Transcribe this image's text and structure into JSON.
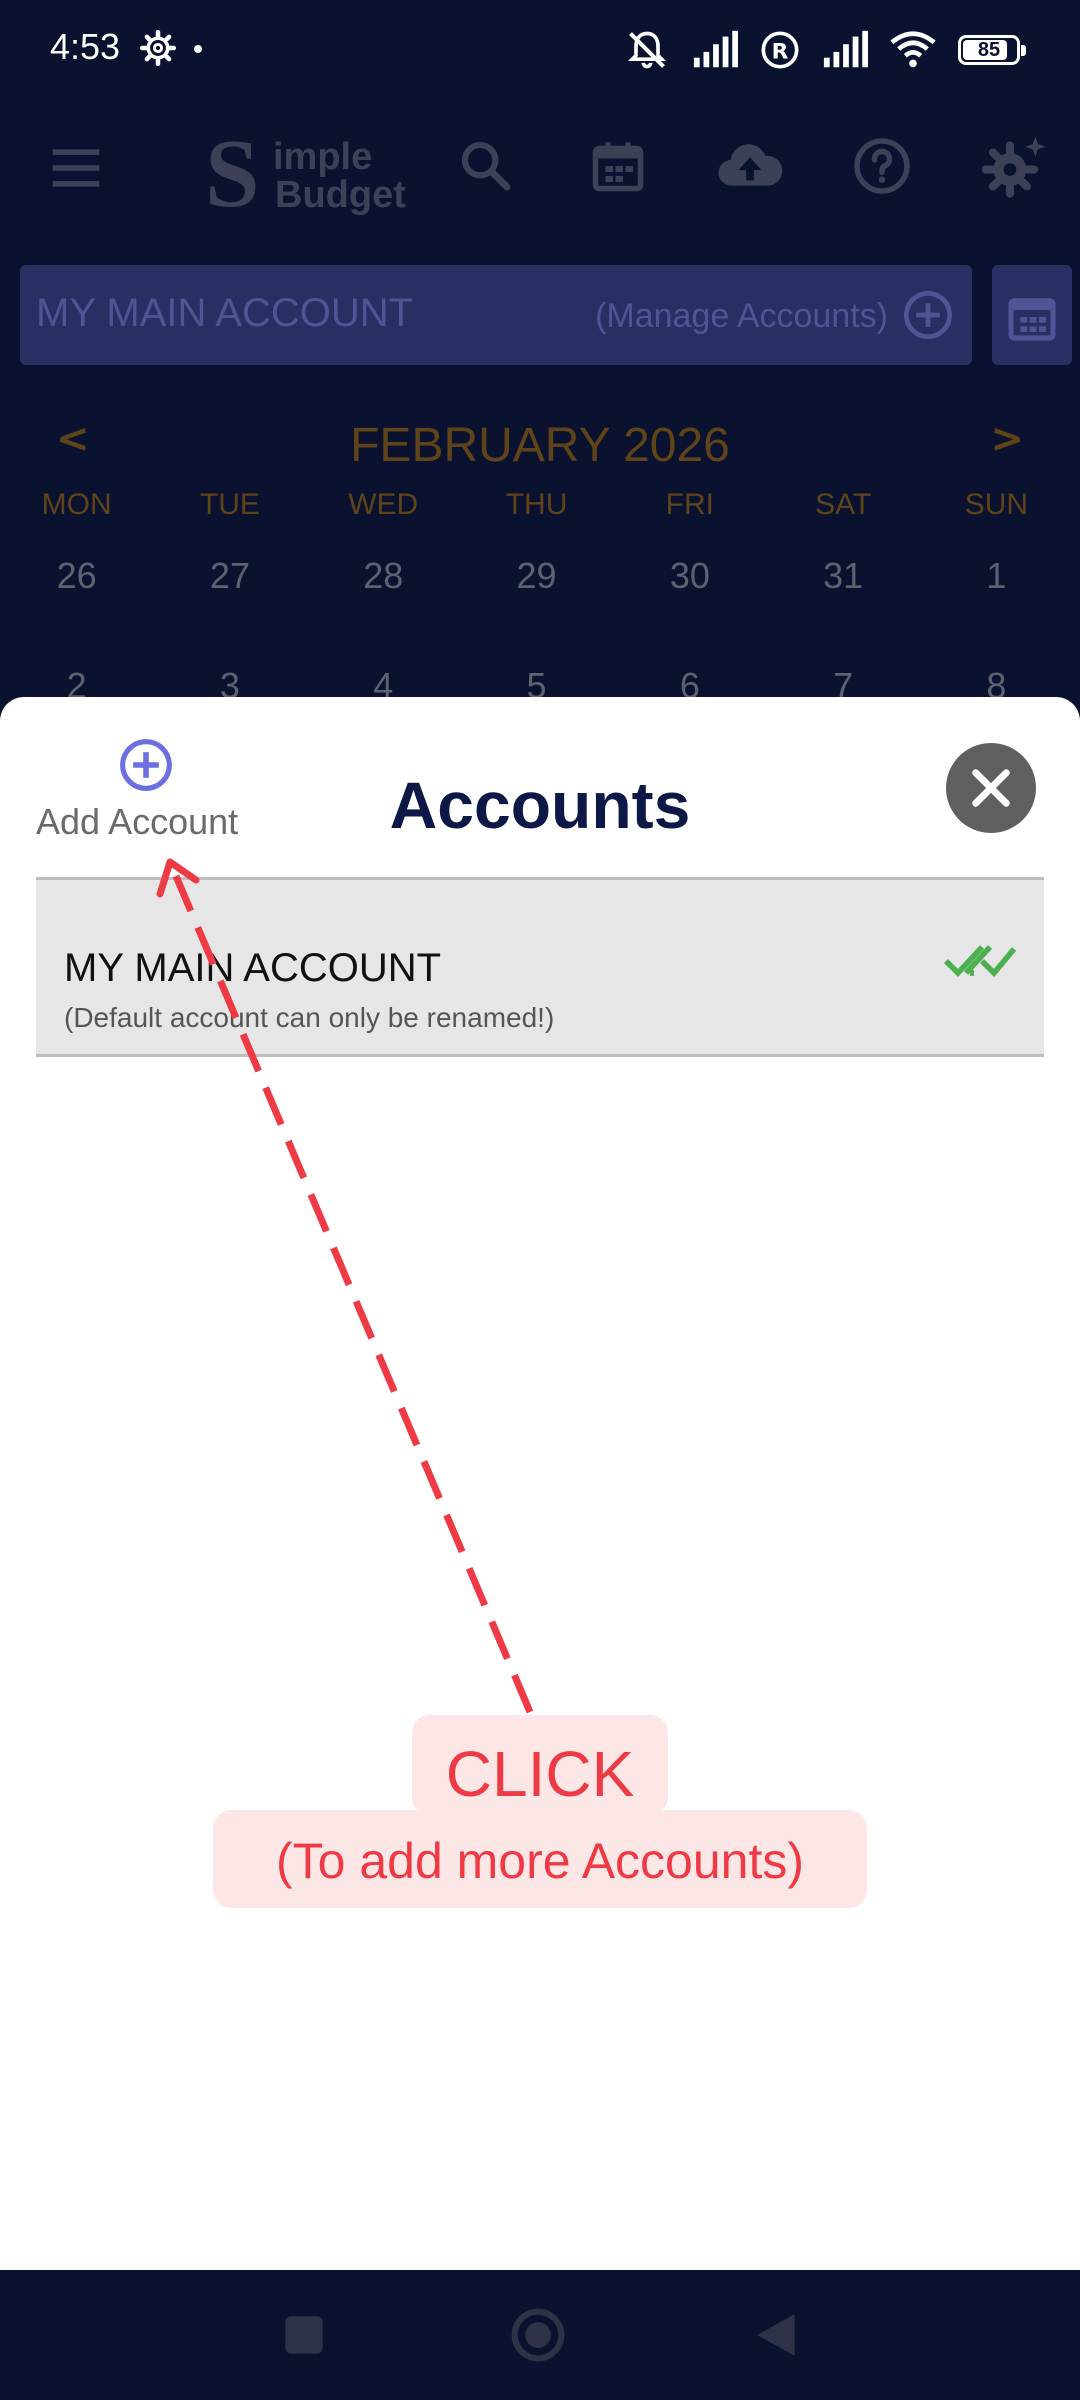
{
  "status_bar": {
    "time": "4:53",
    "battery": "85",
    "battery_level": 0.85
  },
  "app_bar": {
    "logo_letter": "S",
    "logo_line1": "imple",
    "logo_line2": "Budget"
  },
  "account_bar": {
    "account_name": "MY MAIN ACCOUNT",
    "manage_label": "(Manage Accounts)"
  },
  "calendar": {
    "prev": "<",
    "next": ">",
    "month_title": "FEBRUARY 2026",
    "weekdays": [
      "MON",
      "TUE",
      "WED",
      "THU",
      "FRI",
      "SAT",
      "SUN"
    ],
    "row1": [
      "26",
      "27",
      "28",
      "29",
      "30",
      "31",
      "1"
    ],
    "row2": [
      "2",
      "3",
      "4",
      "5",
      "6",
      "7",
      "8"
    ]
  },
  "dialog": {
    "add_account_label": "Add Account",
    "title": "Accounts",
    "accounts": [
      {
        "name": "MY MAIN ACCOUNT",
        "subtitle": "(Default account can only be renamed!)"
      }
    ]
  },
  "annotation": {
    "line1": "CLICK",
    "line2": "(To add more Accounts)"
  },
  "colors": {
    "background": "#0a1230",
    "accent_blue": "#6b6fe0",
    "check_green": "#4caf50",
    "annotation_red": "#ee3a44",
    "title_navy": "#0e1846"
  }
}
